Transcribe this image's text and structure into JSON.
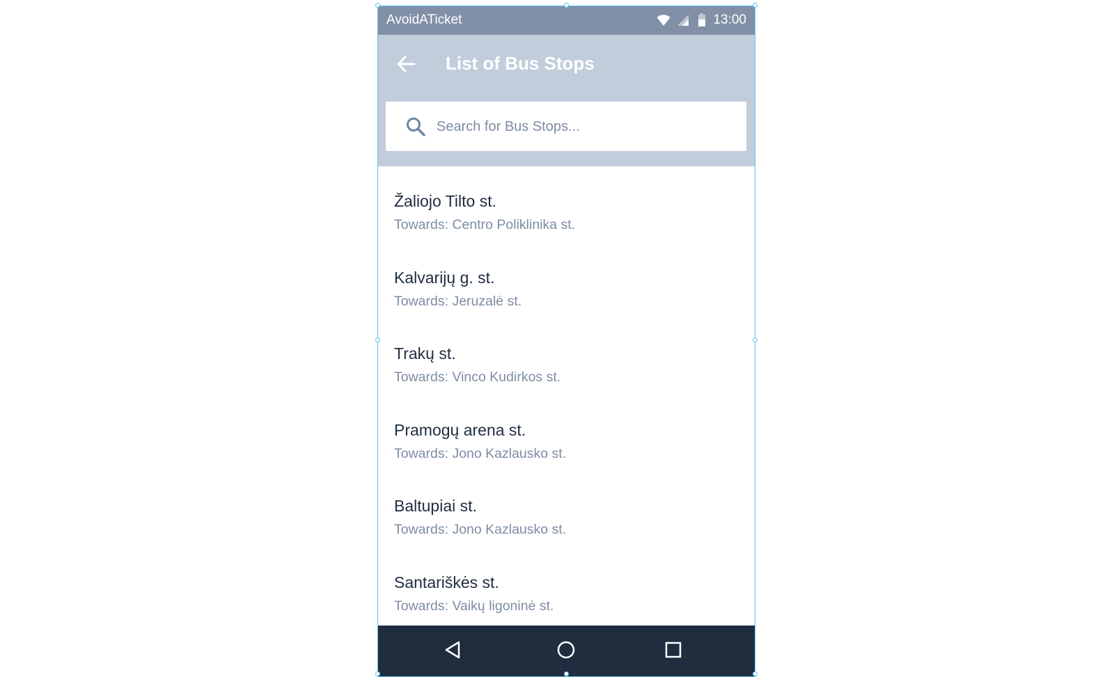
{
  "status_bar": {
    "app_name": "AvoidATicket",
    "time": "13:00",
    "icons": [
      "wifi-icon",
      "signal-icon",
      "battery-icon"
    ]
  },
  "header": {
    "title": "List of Bus Stops",
    "back_icon": "arrow-left-icon"
  },
  "search": {
    "placeholder": "Search for Bus Stops...",
    "value": "",
    "icon": "search-icon"
  },
  "stops": [
    {
      "name": "Žaliojo Tilto st.",
      "towards": "Towards: Centro Poliklinika st."
    },
    {
      "name": "Kalvarijų g. st.",
      "towards": "Towards: Jeruzalė st."
    },
    {
      "name": "Trakų st.",
      "towards": "Towards: Vinco Kudirkos st."
    },
    {
      "name": "Pramogų arena st.",
      "towards": "Towards: Jono Kazlausko st."
    },
    {
      "name": "Baltupiai st.",
      "towards": "Towards: Jono Kazlausko st."
    },
    {
      "name": "Santariškės st.",
      "towards": "Towards: Vaikų ligoninė st."
    }
  ],
  "nav_bar": {
    "buttons": [
      "back-triangle-icon",
      "home-circle-icon",
      "recents-square-icon"
    ]
  },
  "colors": {
    "status_bar": "#8190a6",
    "app_bar": "#c1cddb",
    "primary_text": "#1f2d3f",
    "secondary_text": "#7d8ca3",
    "nav_bar": "#1f2d3f",
    "selection": "#5ec0ec"
  }
}
